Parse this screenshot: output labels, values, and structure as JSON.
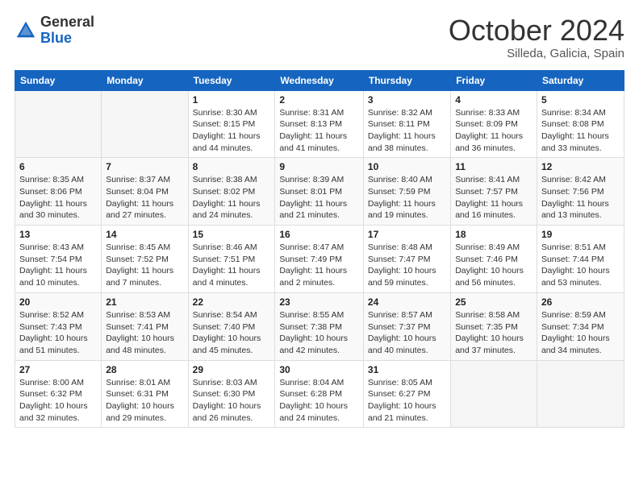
{
  "logo": {
    "general": "General",
    "blue": "Blue"
  },
  "title": {
    "month": "October 2024",
    "location": "Silleda, Galicia, Spain"
  },
  "headers": [
    "Sunday",
    "Monday",
    "Tuesday",
    "Wednesday",
    "Thursday",
    "Friday",
    "Saturday"
  ],
  "weeks": [
    [
      {
        "day": "",
        "info": ""
      },
      {
        "day": "",
        "info": ""
      },
      {
        "day": "1",
        "info": "Sunrise: 8:30 AM\nSunset: 8:15 PM\nDaylight: 11 hours and 44 minutes."
      },
      {
        "day": "2",
        "info": "Sunrise: 8:31 AM\nSunset: 8:13 PM\nDaylight: 11 hours and 41 minutes."
      },
      {
        "day": "3",
        "info": "Sunrise: 8:32 AM\nSunset: 8:11 PM\nDaylight: 11 hours and 38 minutes."
      },
      {
        "day": "4",
        "info": "Sunrise: 8:33 AM\nSunset: 8:09 PM\nDaylight: 11 hours and 36 minutes."
      },
      {
        "day": "5",
        "info": "Sunrise: 8:34 AM\nSunset: 8:08 PM\nDaylight: 11 hours and 33 minutes."
      }
    ],
    [
      {
        "day": "6",
        "info": "Sunrise: 8:35 AM\nSunset: 8:06 PM\nDaylight: 11 hours and 30 minutes."
      },
      {
        "day": "7",
        "info": "Sunrise: 8:37 AM\nSunset: 8:04 PM\nDaylight: 11 hours and 27 minutes."
      },
      {
        "day": "8",
        "info": "Sunrise: 8:38 AM\nSunset: 8:02 PM\nDaylight: 11 hours and 24 minutes."
      },
      {
        "day": "9",
        "info": "Sunrise: 8:39 AM\nSunset: 8:01 PM\nDaylight: 11 hours and 21 minutes."
      },
      {
        "day": "10",
        "info": "Sunrise: 8:40 AM\nSunset: 7:59 PM\nDaylight: 11 hours and 19 minutes."
      },
      {
        "day": "11",
        "info": "Sunrise: 8:41 AM\nSunset: 7:57 PM\nDaylight: 11 hours and 16 minutes."
      },
      {
        "day": "12",
        "info": "Sunrise: 8:42 AM\nSunset: 7:56 PM\nDaylight: 11 hours and 13 minutes."
      }
    ],
    [
      {
        "day": "13",
        "info": "Sunrise: 8:43 AM\nSunset: 7:54 PM\nDaylight: 11 hours and 10 minutes."
      },
      {
        "day": "14",
        "info": "Sunrise: 8:45 AM\nSunset: 7:52 PM\nDaylight: 11 hours and 7 minutes."
      },
      {
        "day": "15",
        "info": "Sunrise: 8:46 AM\nSunset: 7:51 PM\nDaylight: 11 hours and 4 minutes."
      },
      {
        "day": "16",
        "info": "Sunrise: 8:47 AM\nSunset: 7:49 PM\nDaylight: 11 hours and 2 minutes."
      },
      {
        "day": "17",
        "info": "Sunrise: 8:48 AM\nSunset: 7:47 PM\nDaylight: 10 hours and 59 minutes."
      },
      {
        "day": "18",
        "info": "Sunrise: 8:49 AM\nSunset: 7:46 PM\nDaylight: 10 hours and 56 minutes."
      },
      {
        "day": "19",
        "info": "Sunrise: 8:51 AM\nSunset: 7:44 PM\nDaylight: 10 hours and 53 minutes."
      }
    ],
    [
      {
        "day": "20",
        "info": "Sunrise: 8:52 AM\nSunset: 7:43 PM\nDaylight: 10 hours and 51 minutes."
      },
      {
        "day": "21",
        "info": "Sunrise: 8:53 AM\nSunset: 7:41 PM\nDaylight: 10 hours and 48 minutes."
      },
      {
        "day": "22",
        "info": "Sunrise: 8:54 AM\nSunset: 7:40 PM\nDaylight: 10 hours and 45 minutes."
      },
      {
        "day": "23",
        "info": "Sunrise: 8:55 AM\nSunset: 7:38 PM\nDaylight: 10 hours and 42 minutes."
      },
      {
        "day": "24",
        "info": "Sunrise: 8:57 AM\nSunset: 7:37 PM\nDaylight: 10 hours and 40 minutes."
      },
      {
        "day": "25",
        "info": "Sunrise: 8:58 AM\nSunset: 7:35 PM\nDaylight: 10 hours and 37 minutes."
      },
      {
        "day": "26",
        "info": "Sunrise: 8:59 AM\nSunset: 7:34 PM\nDaylight: 10 hours and 34 minutes."
      }
    ],
    [
      {
        "day": "27",
        "info": "Sunrise: 8:00 AM\nSunset: 6:32 PM\nDaylight: 10 hours and 32 minutes."
      },
      {
        "day": "28",
        "info": "Sunrise: 8:01 AM\nSunset: 6:31 PM\nDaylight: 10 hours and 29 minutes."
      },
      {
        "day": "29",
        "info": "Sunrise: 8:03 AM\nSunset: 6:30 PM\nDaylight: 10 hours and 26 minutes."
      },
      {
        "day": "30",
        "info": "Sunrise: 8:04 AM\nSunset: 6:28 PM\nDaylight: 10 hours and 24 minutes."
      },
      {
        "day": "31",
        "info": "Sunrise: 8:05 AM\nSunset: 6:27 PM\nDaylight: 10 hours and 21 minutes."
      },
      {
        "day": "",
        "info": ""
      },
      {
        "day": "",
        "info": ""
      }
    ]
  ]
}
